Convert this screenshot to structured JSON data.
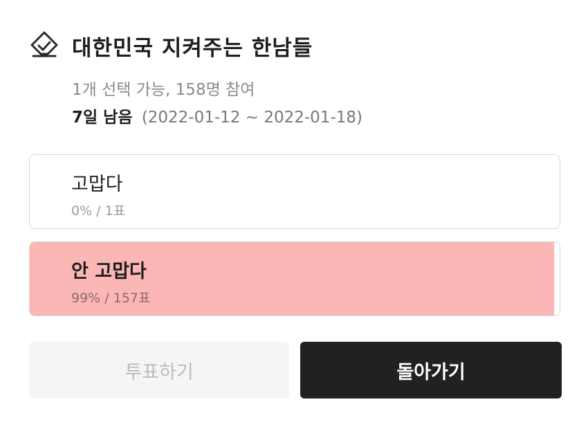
{
  "poll": {
    "title": "대한민국 지켜주는 한남들",
    "meta": "1개 선택 가능, 158명 참여",
    "remaining": "7일 남음",
    "date_range": "(2022-01-12 ~ 2022-01-18)",
    "options": [
      {
        "label": "고맙다",
        "stat": "0% / 1표",
        "percent": 0,
        "votes": 1,
        "selected": false
      },
      {
        "label": "안 고맙다",
        "stat": "99% / 157표",
        "percent": 99,
        "votes": 157,
        "selected": true
      }
    ]
  },
  "buttons": {
    "vote_label": "투표하기",
    "back_label": "돌아가기"
  },
  "icons": {
    "poll": "ballot-check-icon"
  },
  "colors": {
    "result_fill": "#fbb6b6",
    "primary_button": "#212121",
    "disabled_button": "#f5f5f5"
  }
}
